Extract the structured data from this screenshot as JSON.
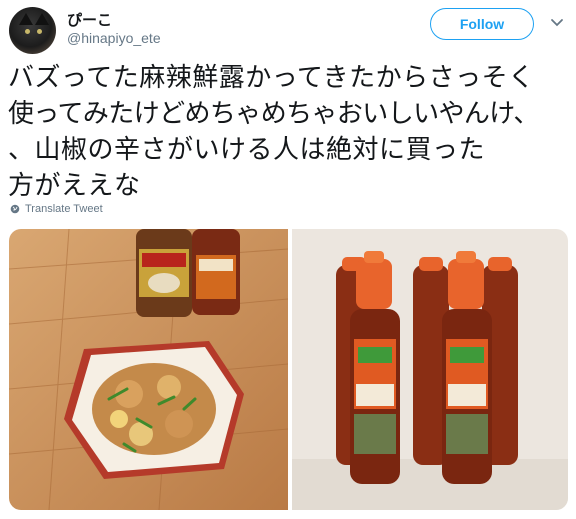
{
  "user": {
    "display_name": "ぴーこ",
    "handle": "@hinapiyo_ete"
  },
  "follow_label": "Follow",
  "tweet": {
    "lines": [
      "バズってた麻辣鮮露かってきたからさっそく",
      "使ってみたけどめちゃめちゃおいしいやんけ、",
      "、山椒の辛さがいける人は絶対に買った",
      "方がええな"
    ]
  },
  "translate_label": "Translate Tweet",
  "icons": {
    "more": "chevron-down-icon",
    "translate": "globe-icon"
  },
  "colors": {
    "accent": "#1da1f2",
    "secondary_text": "#657786",
    "primary_text": "#14171a"
  }
}
